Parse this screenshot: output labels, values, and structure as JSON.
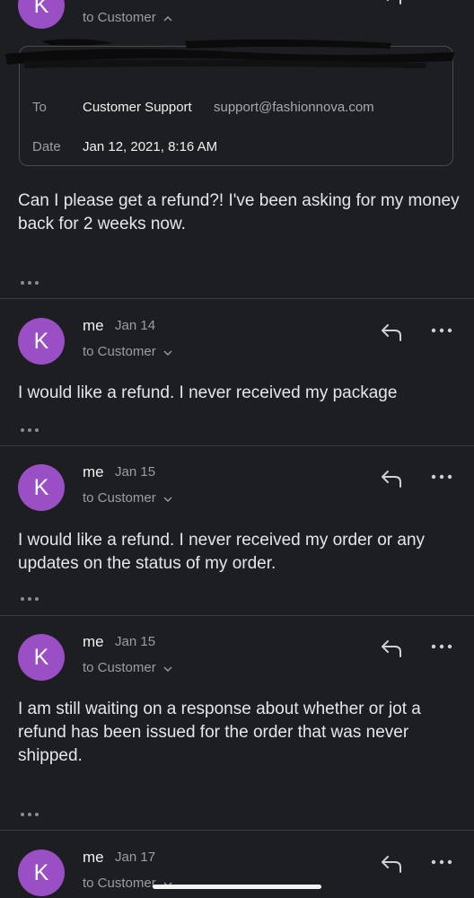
{
  "top_message": {
    "avatar_letter": "K",
    "to_label": "to Customer",
    "details": {
      "to_label": "To",
      "to_name": "Customer Support",
      "to_email": "support@fashionnova.com",
      "date_label": "Date",
      "date_value": "Jan 12, 2021, 8:16 AM"
    },
    "body": "Can I please get a refund?! I've been asking for my money back for 2 weeks now."
  },
  "messages": [
    {
      "avatar_letter": "K",
      "sender": "me",
      "date": "Jan 14",
      "to_label": "to Customer",
      "body": "I would like a refund. I never received my package"
    },
    {
      "avatar_letter": "K",
      "sender": "me",
      "date": "Jan 15",
      "to_label": "to Customer",
      "body": "I would like a refund. I never received my order or any updates on the status of my order."
    },
    {
      "avatar_letter": "K",
      "sender": "me",
      "date": "Jan 15",
      "to_label": "to Customer",
      "body": "I am still waiting on a response about whether or jot a refund has been issued for the order that was never shipped."
    },
    {
      "avatar_letter": "K",
      "sender": "me",
      "date": "Jan 17",
      "to_label": "to Customer"
    }
  ],
  "icons": {
    "reply": "reply-icon",
    "more": "more-icon",
    "chevron_up": "chevron-up-icon",
    "chevron_down": "chevron-down-icon"
  },
  "colors": {
    "background": "#1d1e22",
    "avatar": "#9a4fc4",
    "divider": "#3a3b40"
  }
}
